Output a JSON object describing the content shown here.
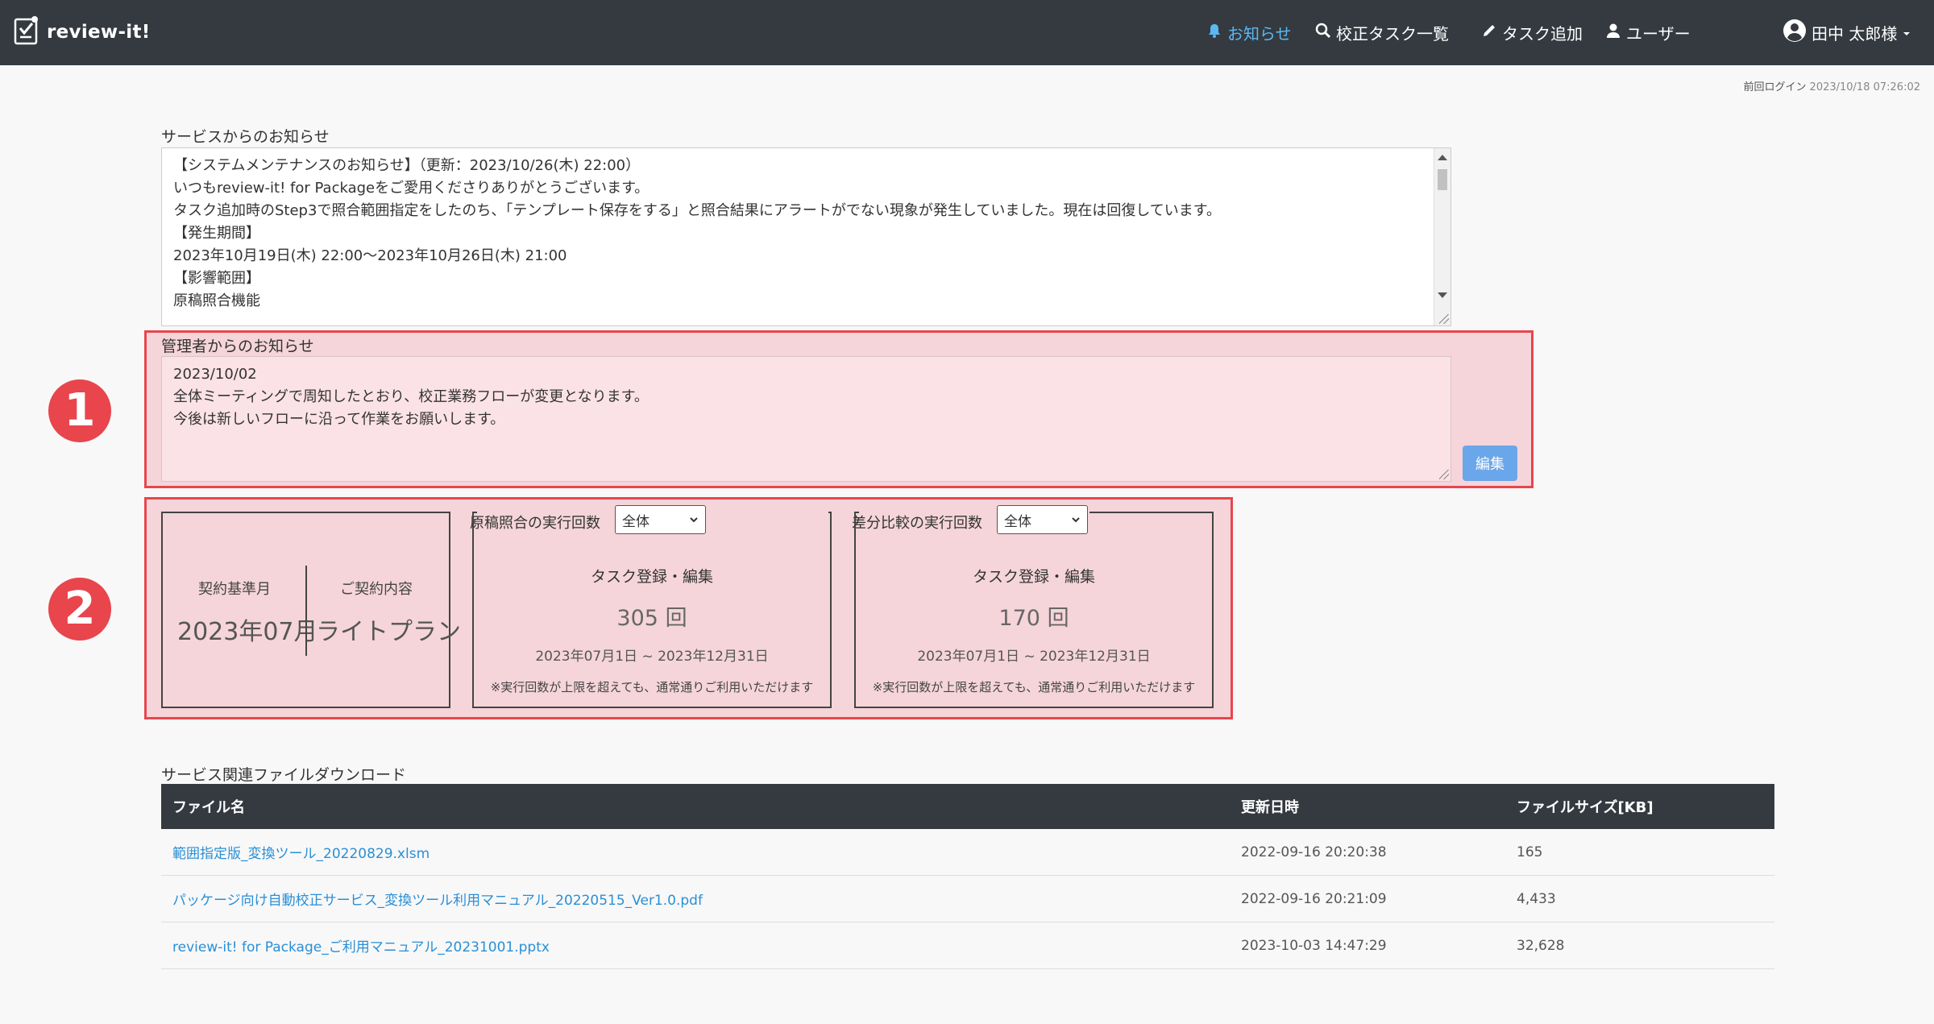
{
  "app": {
    "name": "review-it!"
  },
  "nav": {
    "notices": "お知らせ",
    "task_list": "校正タスク一覧",
    "add_task": "タスク追加",
    "users": "ユーザー",
    "user_name": "田中 太郎様"
  },
  "last_login": {
    "label": "前回ログイン",
    "timestamp": "2023/10/18 07:26:02"
  },
  "service_notice": {
    "label": "サービスからのお知らせ",
    "lines": [
      "【システムメンテナンスのお知らせ】（更新：2023/10/26(木) 22:00）",
      "いつもreview-it! for Packageをご愛用くださりありがとうございます。",
      "タスク追加時のStep3で照合範囲指定をしたのち、「テンプレート保存をする」と照合結果にアラートがでない現象が発生していました。現在は回復しています。",
      "【発生期間】",
      "2023年10月19日(木) 22:00～2023年10月26日(木) 21:00",
      "【影響範囲】",
      "原稿照合機能"
    ]
  },
  "admin_notice": {
    "label": "管理者からのお知らせ",
    "lines": [
      "2023/10/02",
      "全体ミーティングで周知したとおり、校正業務フローが変更となります。",
      "今後は新しいフローに沿って作業をお願いします。"
    ],
    "edit_label": "編集"
  },
  "callouts": {
    "one": "1",
    "two": "2"
  },
  "contract": {
    "base_month_label": "契約基準月",
    "base_month_value": "2023年07月",
    "plan_label": "ご契約内容",
    "plan_value": "ライトプラン"
  },
  "manuscript_runs": {
    "title": "原稿照合の実行回数",
    "filter": "全体",
    "subtitle": "タスク登録・編集",
    "count": "305",
    "unit": "回",
    "period": "2023年07月1日 ~ 2023年12月31日",
    "note": "※実行回数が上限を超えても、通常通りご利用いただけます"
  },
  "diff_runs": {
    "title": "差分比較の実行回数",
    "filter": "全体",
    "subtitle": "タスク登録・編集",
    "count": "170",
    "unit": "回",
    "period": "2023年07月1日 ~ 2023年12月31日",
    "note": "※実行回数が上限を超えても、通常通りご利用いただけます"
  },
  "downloads": {
    "label": "サービス関連ファイルダウンロード",
    "columns": [
      "ファイル名",
      "更新日時",
      "ファイルサイズ[KB]"
    ],
    "rows": [
      {
        "name": "範囲指定版_変換ツール_20220829.xlsm",
        "updated": "2022-09-16 20:20:38",
        "size": "165"
      },
      {
        "name": "パッケージ向け自動校正サービス_変換ツール利用マニュアル_20220515_Ver1.0.pdf",
        "updated": "2022-09-16 20:21:09",
        "size": "4,433"
      },
      {
        "name": "review-it! for Package_ご利用マニュアル_20231001.pptx",
        "updated": "2023-10-03 14:47:29",
        "size": "32,628"
      }
    ]
  }
}
